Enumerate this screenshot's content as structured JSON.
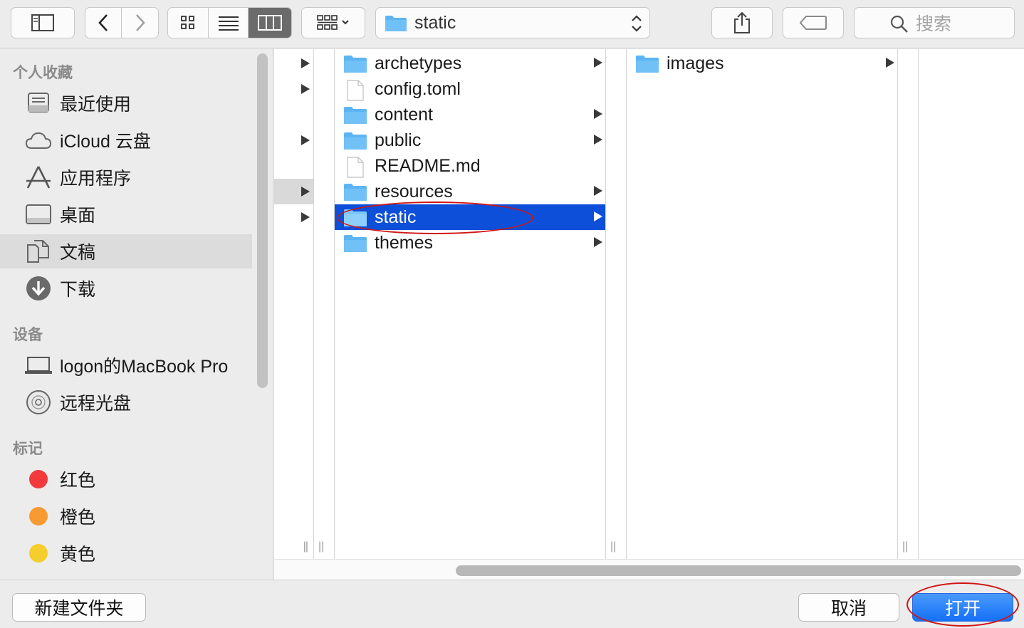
{
  "toolbar": {
    "path_label": "static",
    "search_placeholder": "搜索"
  },
  "sidebar": {
    "favorites_header": "个人收藏",
    "favorites": [
      {
        "label": "最近使用",
        "icon": "recents-icon"
      },
      {
        "label": "iCloud 云盘",
        "icon": "icloud-icon"
      },
      {
        "label": "应用程序",
        "icon": "applications-icon"
      },
      {
        "label": "桌面",
        "icon": "desktop-icon"
      },
      {
        "label": "文稿",
        "icon": "documents-icon",
        "selected": true
      },
      {
        "label": "下载",
        "icon": "downloads-icon"
      }
    ],
    "devices_header": "设备",
    "devices": [
      {
        "label": "logon的MacBook Pro",
        "icon": "laptop-icon"
      },
      {
        "label": "远程光盘",
        "icon": "disc-icon"
      }
    ],
    "tags_header": "标记",
    "tags": [
      {
        "label": "红色",
        "color": "#f2393c"
      },
      {
        "label": "橙色",
        "color": "#f79a32"
      },
      {
        "label": "黄色",
        "color": "#f5cd2c"
      }
    ]
  },
  "columns": {
    "col2": [
      {
        "name": "archetypes",
        "type": "folder"
      },
      {
        "name": "config.toml",
        "type": "file"
      },
      {
        "name": "content",
        "type": "folder"
      },
      {
        "name": "public",
        "type": "folder"
      },
      {
        "name": "README.md",
        "type": "file"
      },
      {
        "name": "resources",
        "type": "folder"
      },
      {
        "name": "static",
        "type": "folder",
        "selected": true
      },
      {
        "name": "themes",
        "type": "folder"
      }
    ],
    "col3": [
      {
        "name": "images",
        "type": "folder"
      }
    ]
  },
  "buttons": {
    "new_folder": "新建文件夹",
    "cancel": "取消",
    "open": "打开"
  },
  "colors": {
    "selection": "#0d4fd8",
    "folder": "#5db4f3",
    "annotation": "#d01515"
  }
}
